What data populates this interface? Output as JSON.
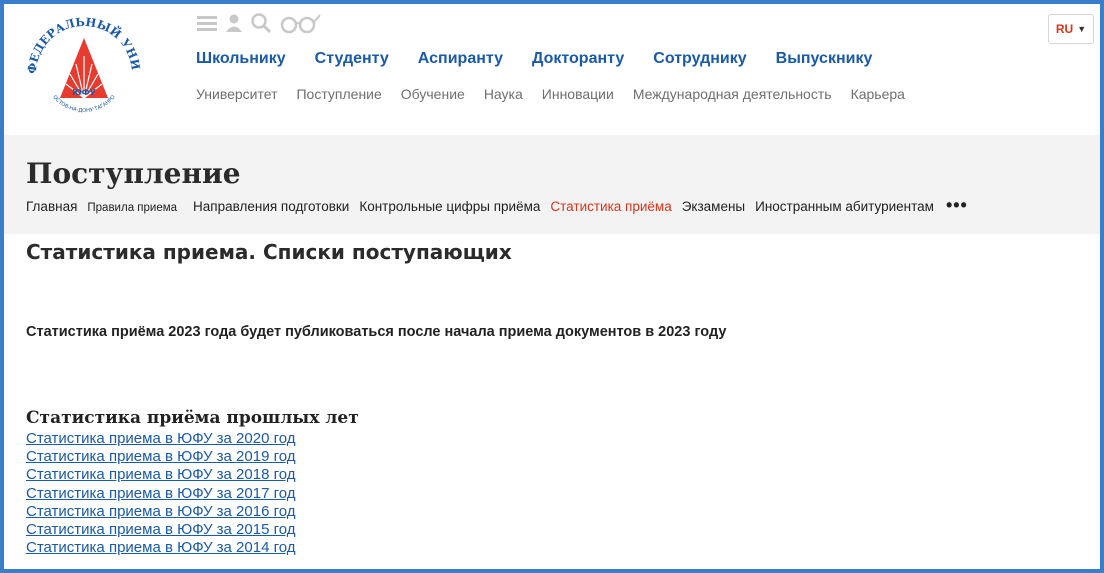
{
  "logo": {
    "arc_text": "ЮЖНЫЙ ФЕДЕРАЛЬНЫЙ УНИВЕРСИТЕТ",
    "abbr": "ЮФУ",
    "city_text": "РОСТОВ-НА-ДОНУ·ТАГАНРОГ",
    "colors": {
      "red": "#e63b2e",
      "blue": "#1a5aa6"
    }
  },
  "toolbar_icons": [
    "menu-icon",
    "user-icon",
    "search-icon",
    "glasses-icon"
  ],
  "main_nav": [
    "Школьнику",
    "Студенту",
    "Аспиранту",
    "Докторанту",
    "Сотруднику",
    "Выпускнику"
  ],
  "sub_nav": [
    "Университет",
    "Поступление",
    "Обучение",
    "Наука",
    "Инновации",
    "Международная деятельность",
    "Карьера"
  ],
  "lang": {
    "code": "RU",
    "caret": "▼"
  },
  "section": {
    "title": "Поступление",
    "crumbs": [
      {
        "label": "Главная",
        "variant": ""
      },
      {
        "label": "Правила приема",
        "variant": "small"
      },
      {
        "label": "Направления подготовки",
        "variant": ""
      },
      {
        "label": "Контрольные цифры приёма",
        "variant": ""
      },
      {
        "label": "Статистика приёма",
        "variant": "active"
      },
      {
        "label": "Экзамены",
        "variant": ""
      },
      {
        "label": "Иностранным абитуриентам",
        "variant": ""
      }
    ],
    "more": "•••"
  },
  "content": {
    "heading": "Статистика приема. Списки поступающих",
    "notice": "Статистика приёма 2023 года будет публиковаться после начала приема документов в 2023 году",
    "past_title": "Статистика приёма прошлых лет",
    "links": [
      "Статистика приема в ЮФУ за 2020 год",
      "Статистика приема в ЮФУ за 2019 год",
      "Статистика приема в ЮФУ за 2018 год",
      "Статистика приема в ЮФУ за 2017 год",
      "Статистика приема в ЮФУ за 2016 год",
      "Статистика приема в ЮФУ за 2015 год",
      "Статистика приема в ЮФУ за 2014 год"
    ]
  },
  "colors": {
    "frame": "#3a7dc9",
    "link": "#1a5aa6",
    "active": "#d9361a",
    "band": "#f3f3f3"
  }
}
